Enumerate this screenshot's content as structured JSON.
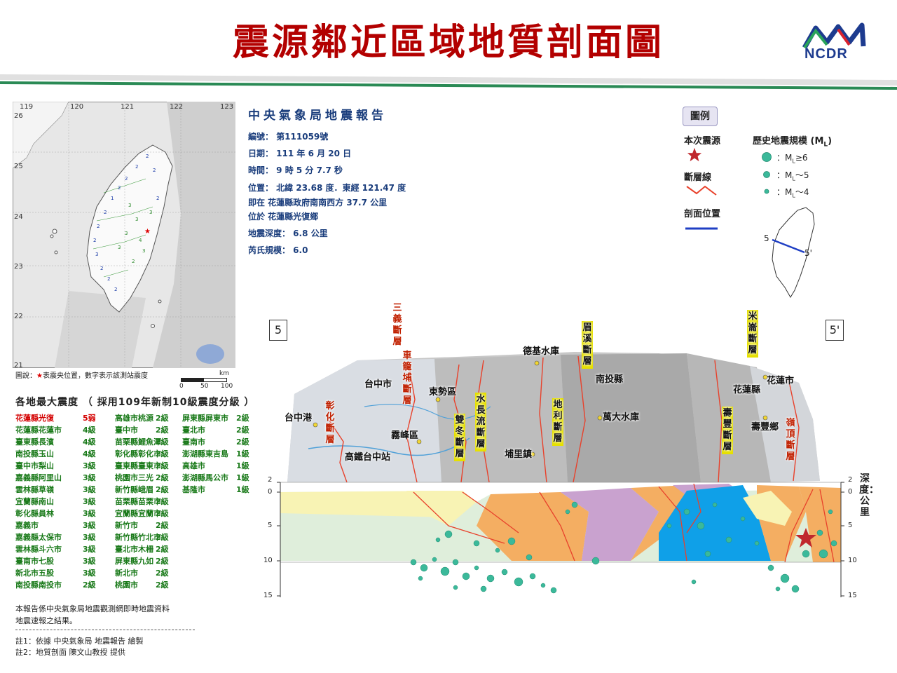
{
  "title": "震源鄰近區域地質剖面圖",
  "logo": {
    "text": "NCDR"
  },
  "map": {
    "lon_ticks": [
      "119",
      "120",
      "121",
      "122",
      "123"
    ],
    "lat_ticks": [
      "26",
      "25",
      "24",
      "23",
      "22",
      "21"
    ],
    "caption_prefix": "圖說：",
    "caption_star": "★",
    "caption_rest": "表震央位置，數字表示該測站震度",
    "scale_unit": "km",
    "scale_labels": [
      "0",
      "50",
      "100"
    ]
  },
  "intensity": {
    "title": "各地最大震度 （ 採用109年新制10級震度分級 ）",
    "col1": [
      {
        "name": "花蓮縣光復",
        "level": "5弱",
        "color": "#d40000"
      },
      {
        "name": "花蓮縣花蓮市",
        "level": "4級",
        "color": "#1a7a1a"
      },
      {
        "name": "臺東縣長濱",
        "level": "4級",
        "color": "#1a7a1a"
      },
      {
        "name": "南投縣玉山",
        "level": "4級",
        "color": "#1a7a1a"
      },
      {
        "name": "臺中市梨山",
        "level": "3級",
        "color": "#1a7a1a"
      },
      {
        "name": "嘉義縣阿里山",
        "level": "3級",
        "color": "#1a7a1a"
      },
      {
        "name": "雲林縣草嶺",
        "level": "3級",
        "color": "#1a7a1a"
      },
      {
        "name": "宜蘭縣南山",
        "level": "3級",
        "color": "#1a7a1a"
      },
      {
        "name": "彰化縣員林",
        "level": "3級",
        "color": "#1a7a1a"
      },
      {
        "name": "嘉義市",
        "level": "3級",
        "color": "#1a7a1a"
      },
      {
        "name": "嘉義縣太保市",
        "level": "3級",
        "color": "#1a7a1a"
      },
      {
        "name": "雲林縣斗六市",
        "level": "3級",
        "color": "#1a7a1a"
      },
      {
        "name": "臺南市七股",
        "level": "3級",
        "color": "#1a7a1a"
      },
      {
        "name": "新北市五股",
        "level": "3級",
        "color": "#1a7a1a"
      },
      {
        "name": "南投縣南投市",
        "level": "2級",
        "color": "#1a7a1a"
      }
    ],
    "col2": [
      {
        "name": "高雄市桃源",
        "level": "2級"
      },
      {
        "name": "臺中市",
        "level": "2級"
      },
      {
        "name": "苗栗縣鯉魚潭",
        "level": "2級"
      },
      {
        "name": "彰化縣彰化市",
        "level": "2級"
      },
      {
        "name": "臺東縣臺東市",
        "level": "2級"
      },
      {
        "name": "桃園市三光",
        "level": "2級"
      },
      {
        "name": "新竹縣峨眉",
        "level": "2級"
      },
      {
        "name": "苗栗縣苗栗市",
        "level": "2級"
      },
      {
        "name": "宜蘭縣宜蘭市",
        "level": "2級"
      },
      {
        "name": "新竹市",
        "level": "2級"
      },
      {
        "name": "新竹縣竹北市",
        "level": "2級"
      },
      {
        "name": "臺北市木柵",
        "level": "2級"
      },
      {
        "name": "屏東縣九如",
        "level": "2級"
      },
      {
        "name": "新北市",
        "level": "2級"
      },
      {
        "name": "桃園市",
        "level": "2級"
      }
    ],
    "col3": [
      {
        "name": "屏東縣屏東市",
        "level": "2級"
      },
      {
        "name": "臺北市",
        "level": "2級"
      },
      {
        "name": "臺南市",
        "level": "2級"
      },
      {
        "name": "澎湖縣東吉島",
        "level": "1級"
      },
      {
        "name": "高雄市",
        "level": "1級"
      },
      {
        "name": "澎湖縣馬公市",
        "level": "1級"
      },
      {
        "name": "基隆市",
        "level": "1級"
      }
    ],
    "note1": "本報告係中央氣象局地震觀測網即時地震資料",
    "note2": "地震速報之結果。",
    "footnote1": "註1：依據 中央氣象局 地震報告 繪製",
    "footnote2": "註2：地質剖面 陳文山教授 提供"
  },
  "report": {
    "title": "中央氣象局地震報告",
    "rows": [
      "編號： 第111059號",
      "日期： 111 年 6 月 20 日",
      "時間： 9 時 5 分 7.7 秒",
      "位置： 北緯 23.68 度．東經 121.47 度",
      "即在 花蓮縣政府南南西方 37.7 公里",
      "位於 花蓮縣光復鄉",
      "地震深度： 6.8 公里",
      "芮氏規模： 6.0"
    ]
  },
  "legend": {
    "box": "圖例",
    "epicenter": "本次震源",
    "fault": "斷層線",
    "profile": "剖面位置",
    "history": "歷史地震規模 (M",
    "history_sub": "L",
    "history_close": ")",
    "m6": "：M",
    "m6_rest": "≥6",
    "m5_rest": "～5",
    "m4_rest": "～4",
    "inset_5": "5",
    "inset_5p": "5'",
    "colors": {
      "eq": "#3bb99a",
      "star": "#c0282d",
      "fault": "#e8412b",
      "profile": "#1f3fc4"
    }
  },
  "section": {
    "end_left": "5",
    "end_right": "5'",
    "places": [
      "台中市",
      "東勢區",
      "德基水庫",
      "南投縣",
      "花蓮市",
      "花蓮縣",
      "台中港",
      "霧峰區",
      "萬大水庫",
      "壽豐鄉",
      "高鐵台中站",
      "埔里鎮"
    ],
    "faults": [
      "三義斷層",
      "車籠埔斷層",
      "彰化斷層",
      "雙冬斷層",
      "水長流斷層",
      "眉溪斷層",
      "地利斷層",
      "壽豐斷層",
      "米崙斷層",
      "嶺頂斷層"
    ],
    "depth_title": "深度：公里",
    "depth_left": [
      "2",
      "0",
      "5",
      "10",
      "15"
    ],
    "depth_right": [
      "2",
      "0",
      "5",
      "10",
      "15"
    ]
  }
}
